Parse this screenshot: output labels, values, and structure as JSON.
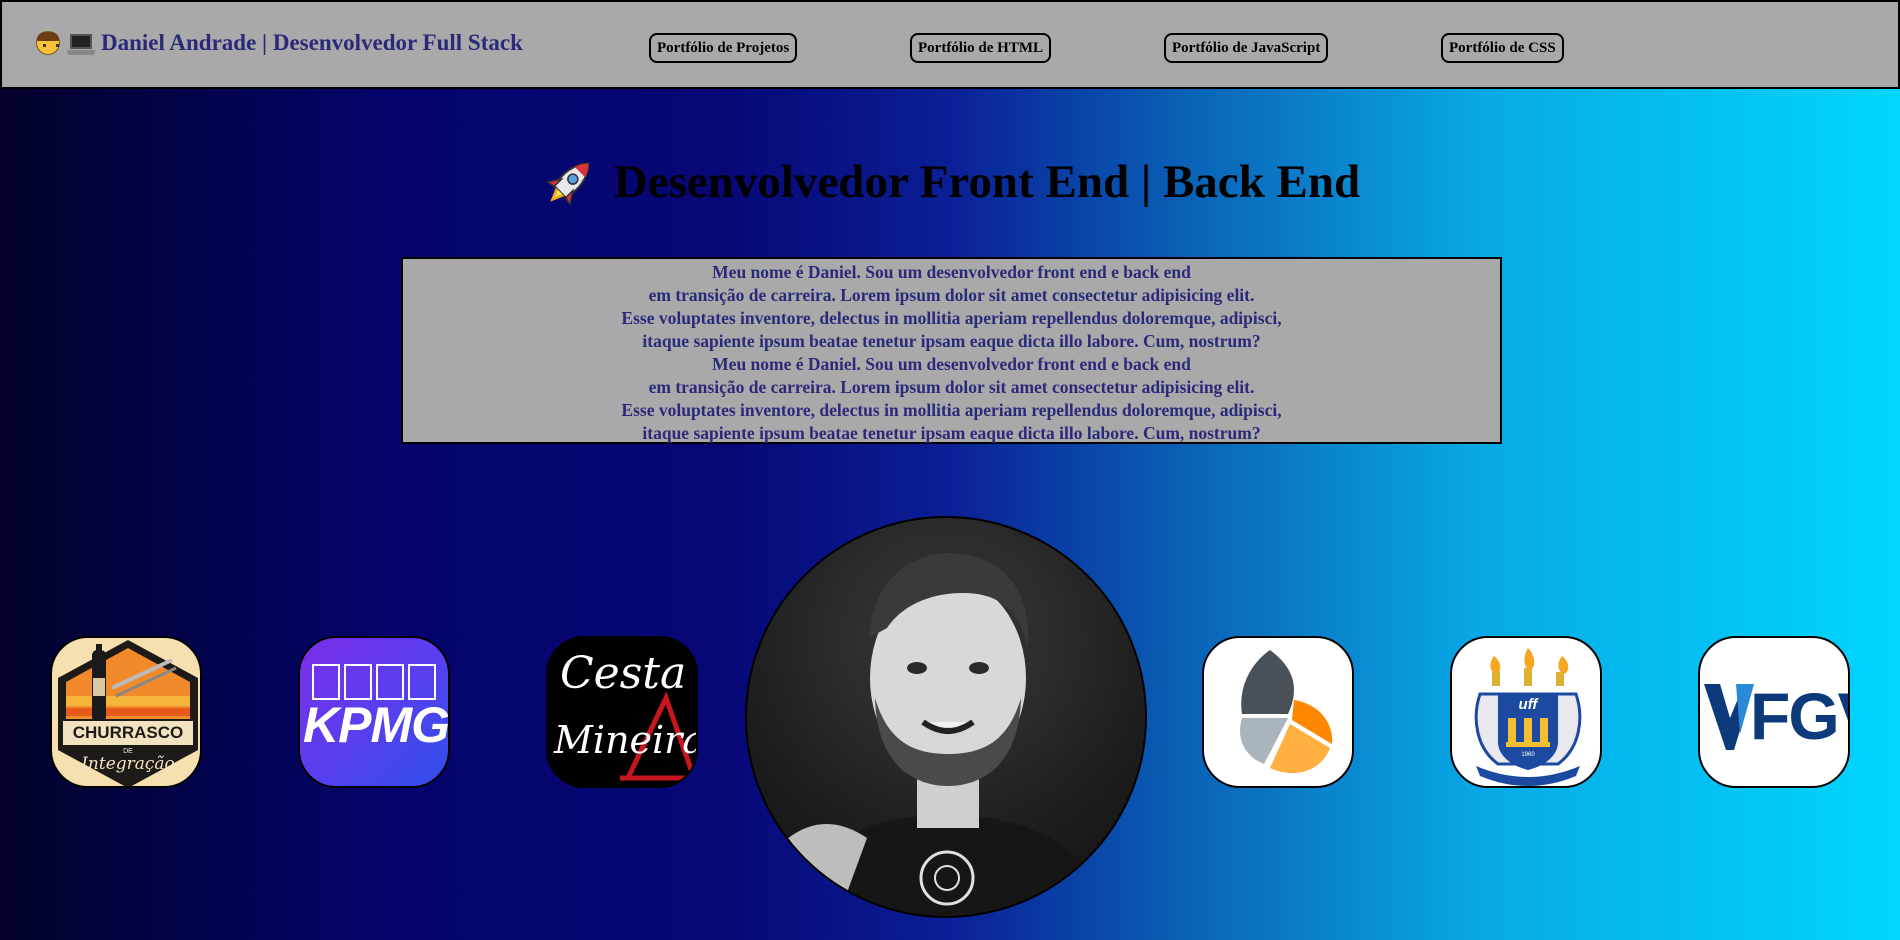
{
  "navbar": {
    "brand": "Daniel Andrade | Desenvolvedor Full Stack",
    "links": [
      "Portfólio de Projetos",
      "Portfólio de HTML",
      "Portfólio de JavaScript",
      "Portfólio de CSS"
    ]
  },
  "hero": {
    "title": "Desenvolvedor Front End | Back End",
    "about_lines": [
      "Meu nome é Daniel. Sou um desenvolvedor front end e back end",
      "em transição de carreira. Lorem ipsum dolor sit amet consectetur adipisicing elit.",
      "Esse voluptates inventore, delectus in mollitia aperiam repellendus doloremque, adipisci,",
      "itaque sapiente ipsum beatae tenetur ipsam eaque dicta illo labore. Cum, nostrum?",
      "Meu nome é Daniel. Sou um desenvolvedor front end e back end",
      "em transição de carreira. Lorem ipsum dolor sit amet consectetur adipisicing elit.",
      "Esse voluptates inventore, delectus in mollitia aperiam repellendus doloremque, adipisci,",
      "itaque sapiente ipsum beatae tenetur ipsam eaque dicta illo labore. Cum, nostrum?"
    ]
  },
  "logos": {
    "churrasco": {
      "top": "CHURRASCO",
      "de": "DE",
      "bottom": "Integração"
    },
    "kpmg": "KPMG",
    "cesta": {
      "line1": "Cesta",
      "line2": "Mineira"
    },
    "uff": {
      "text": "uff",
      "year": "1960"
    },
    "fgv": "FGV"
  },
  "colors": {
    "brand_text": "#2a2a7a",
    "navbar_bg": "#a9a9a9"
  }
}
